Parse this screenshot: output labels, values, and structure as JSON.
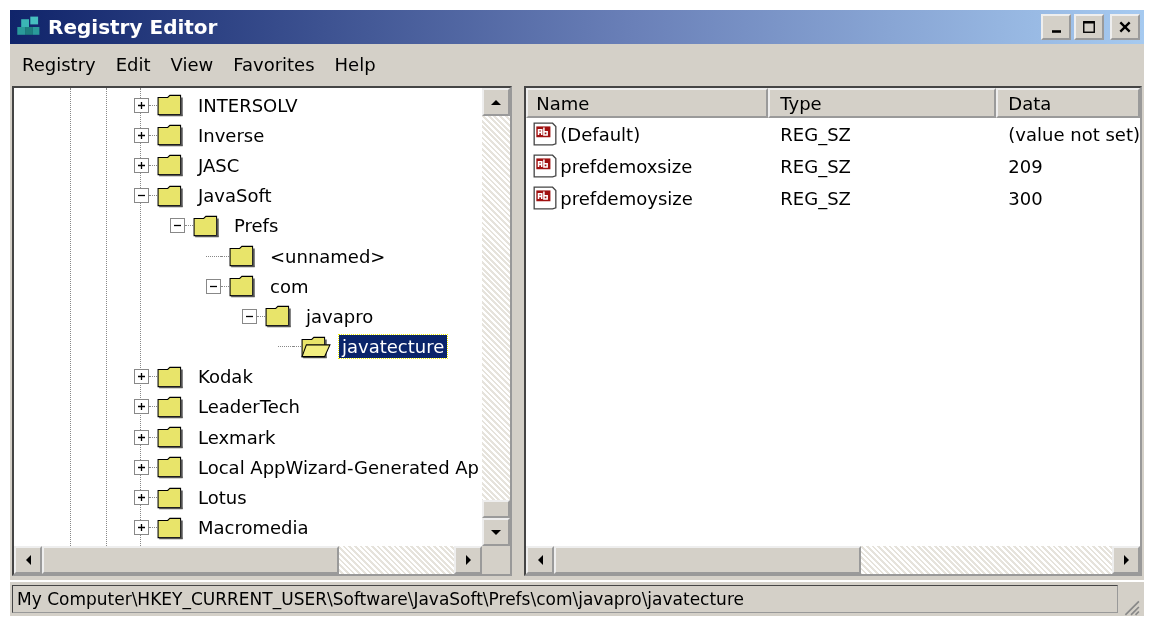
{
  "window": {
    "title": "Registry Editor"
  },
  "menu": [
    "Registry",
    "Edit",
    "View",
    "Favorites",
    "Help"
  ],
  "tree": [
    {
      "label": "INTERSOLV",
      "kind": "branch",
      "expanded": false,
      "selected": false
    },
    {
      "label": "Inverse",
      "kind": "branch",
      "expanded": false,
      "selected": false
    },
    {
      "label": "JASC",
      "kind": "branch",
      "expanded": false,
      "selected": false
    },
    {
      "label": "JavaSoft",
      "kind": "branch",
      "expanded": true,
      "selected": false,
      "children": [
        {
          "label": "Prefs",
          "kind": "branch",
          "expanded": true,
          "selected": false,
          "children": [
            {
              "label": "<unnamed>",
              "kind": "leaf",
              "selected": false
            },
            {
              "label": "com",
              "kind": "branch",
              "expanded": true,
              "selected": false,
              "children": [
                {
                  "label": "javapro",
                  "kind": "branch",
                  "expanded": true,
                  "selected": false,
                  "children": [
                    {
                      "label": "javatecture",
                      "kind": "leaf",
                      "selected": true
                    }
                  ]
                }
              ]
            }
          ]
        }
      ]
    },
    {
      "label": "Kodak",
      "kind": "branch",
      "expanded": false,
      "selected": false
    },
    {
      "label": "LeaderTech",
      "kind": "branch",
      "expanded": false,
      "selected": false
    },
    {
      "label": "Lexmark",
      "kind": "branch",
      "expanded": false,
      "selected": false
    },
    {
      "label": "Local AppWizard-Generated Ap",
      "kind": "branch",
      "expanded": false,
      "selected": false
    },
    {
      "label": "Lotus",
      "kind": "branch",
      "expanded": false,
      "selected": false
    },
    {
      "label": "Macromedia",
      "kind": "branch",
      "expanded": false,
      "selected": false
    }
  ],
  "values": {
    "columns": [
      "Name",
      "Type",
      "Data"
    ],
    "rows": [
      {
        "name": "(Default)",
        "type": "REG_SZ",
        "data": "(value not set)"
      },
      {
        "name": "prefdemoxsize",
        "type": "REG_SZ",
        "data": "209"
      },
      {
        "name": "prefdemoysize",
        "type": "REG_SZ",
        "data": "300"
      }
    ]
  },
  "status_bar": "My Computer\\HKEY_CURRENT_USER\\Software\\JavaSoft\\Prefs\\com\\javapro\\javatecture"
}
